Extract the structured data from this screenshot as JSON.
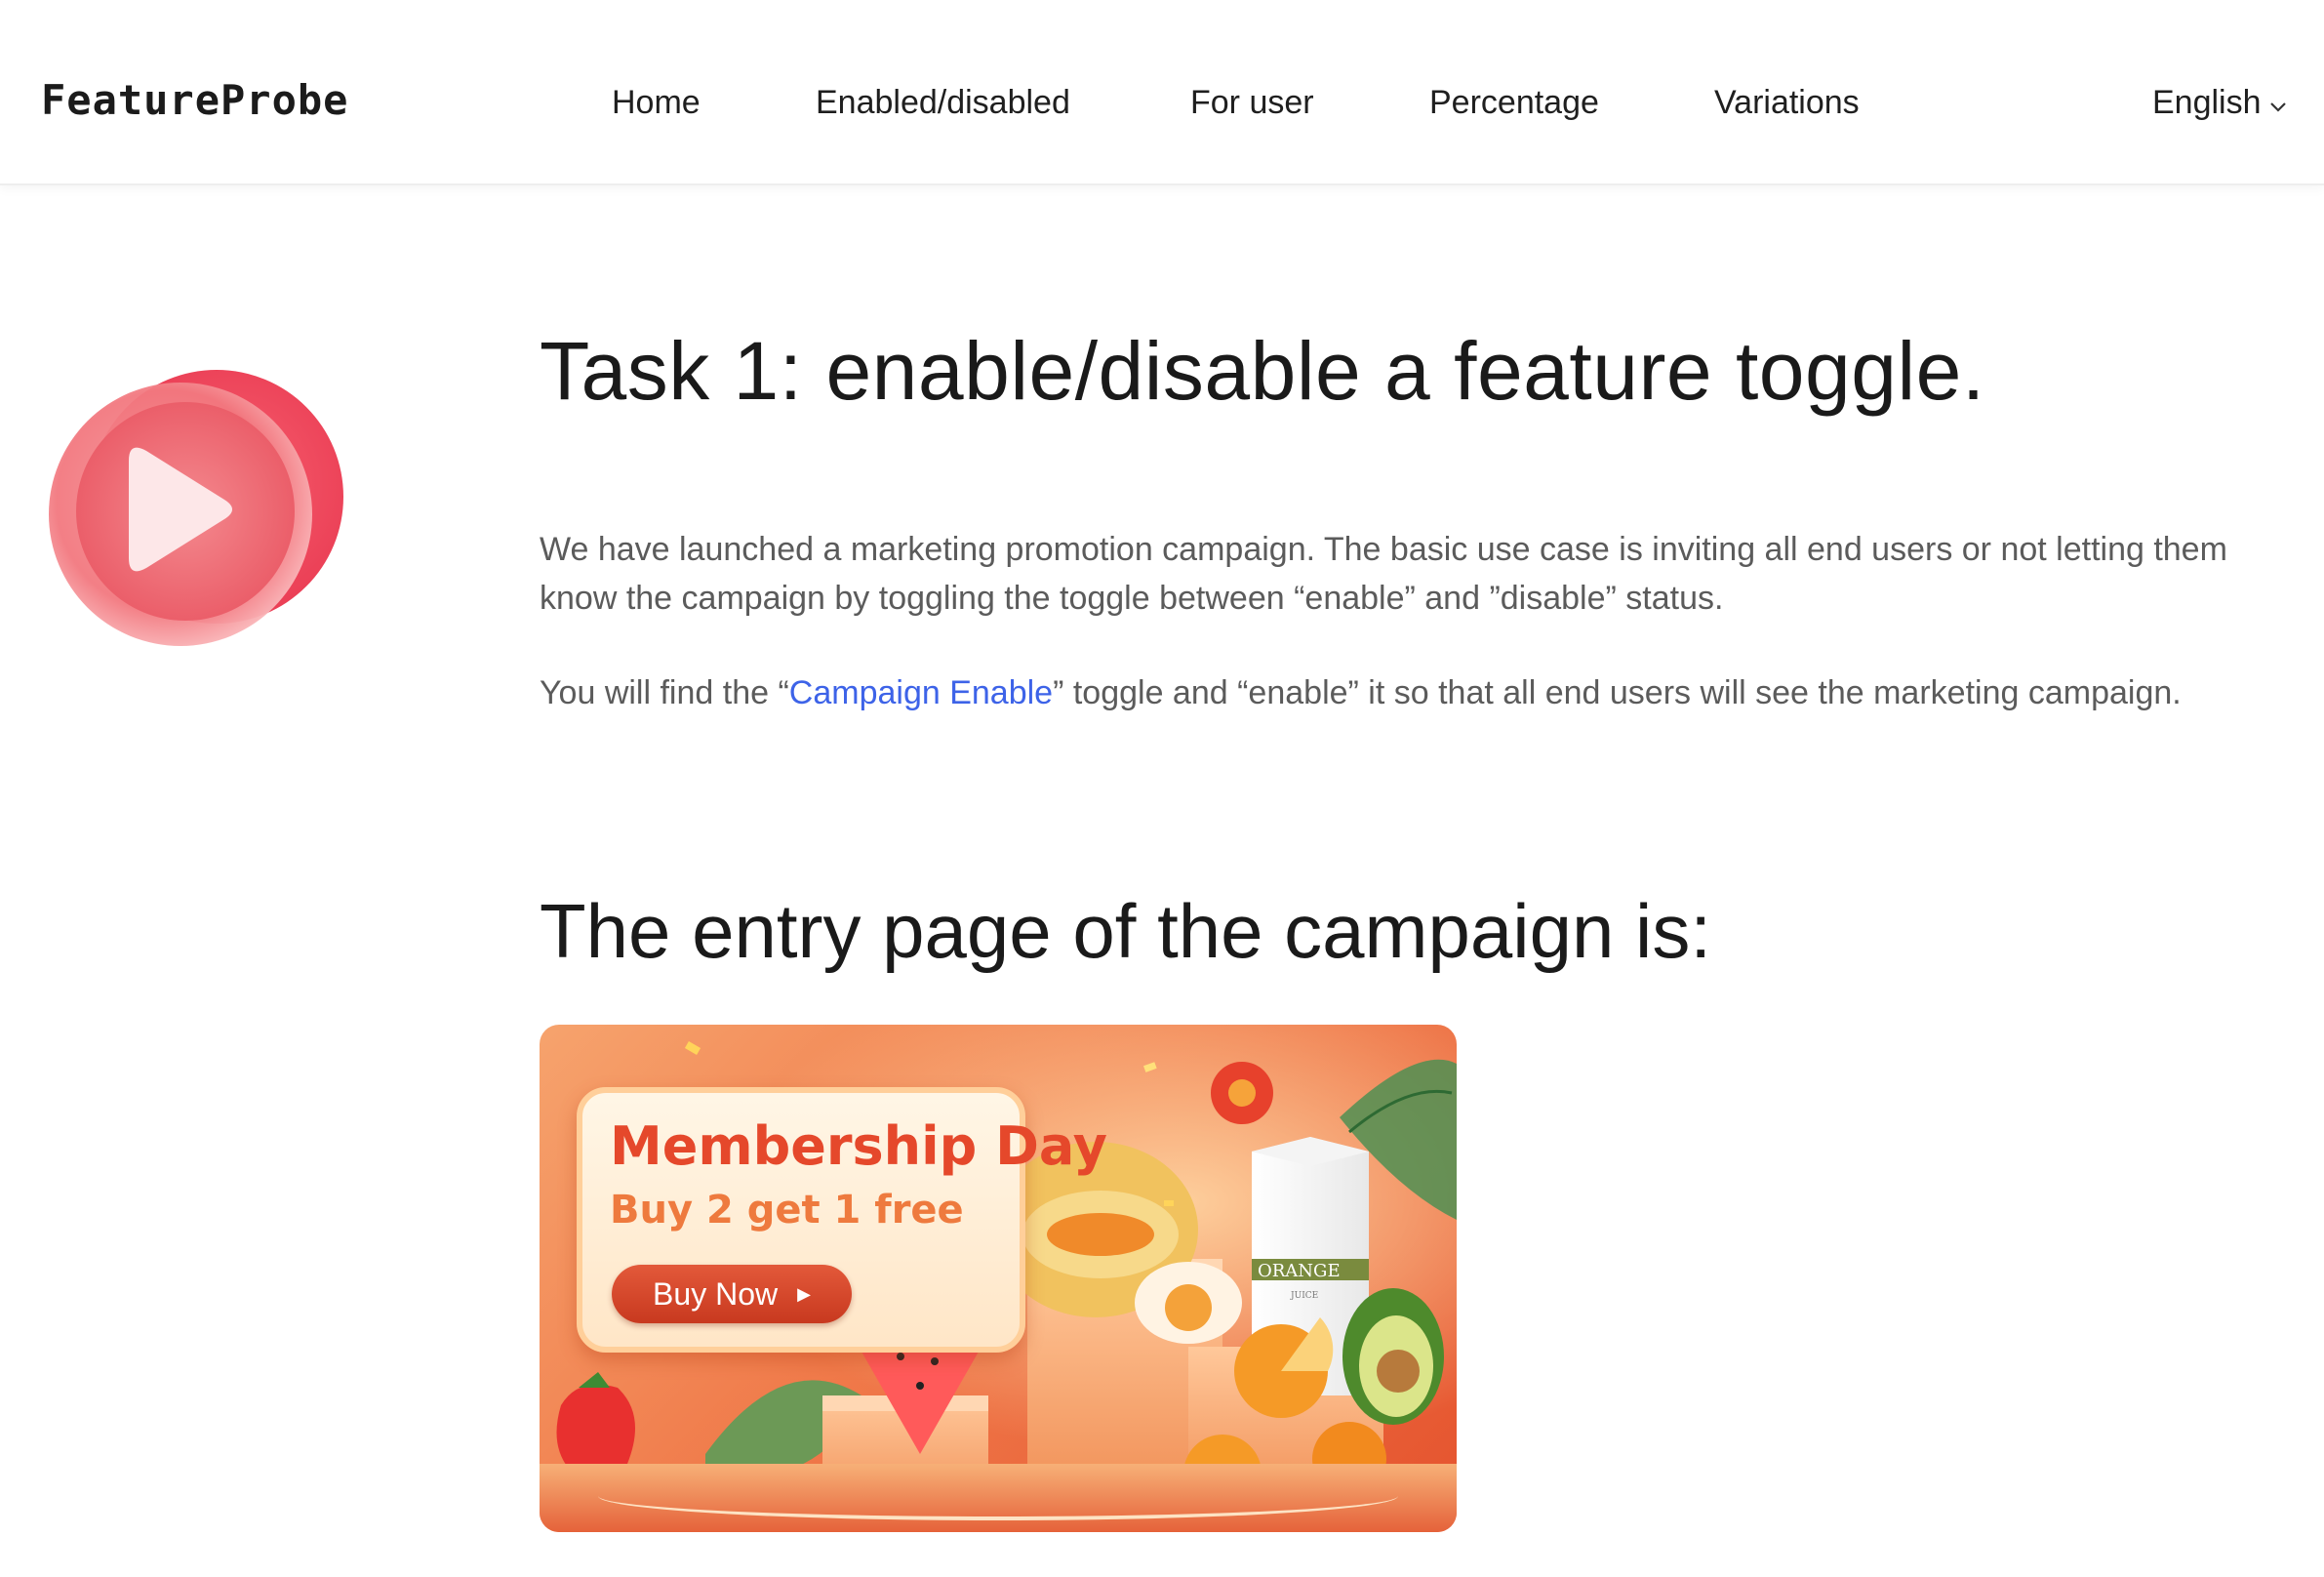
{
  "header": {
    "logo": "FeatureProbe",
    "nav": [
      {
        "label": "Home"
      },
      {
        "label": "Enabled/disabled"
      },
      {
        "label": "For user"
      },
      {
        "label": "Percentage"
      },
      {
        "label": "Variations"
      }
    ],
    "language": "English",
    "language_icon": "chevron-down-icon"
  },
  "hero_icon": "play-icon",
  "content": {
    "title": "Task 1: enable/disable a feature toggle.",
    "paragraph1": "We have launched a marketing promotion campaign. The basic use case is inviting all end users or not letting them know the campaign by toggling the toggle between “enable” and ”disable” status.",
    "paragraph2": {
      "before": "You will find the “",
      "link": "Campaign Enable",
      "after": "” toggle and “enable” it so that all end users will see the marketing campaign."
    },
    "subtitle": "The entry page of the campaign is:"
  },
  "banner": {
    "title": "Membership Day",
    "subtitle": "Buy 2 get 1 free",
    "button": "Buy Now",
    "carton_label": "ORANGE",
    "carton_sub": "JUICE"
  },
  "colors": {
    "link": "#3d63e8",
    "banner_primary": "#e5532e",
    "play_icon": "#ee4a5e"
  }
}
